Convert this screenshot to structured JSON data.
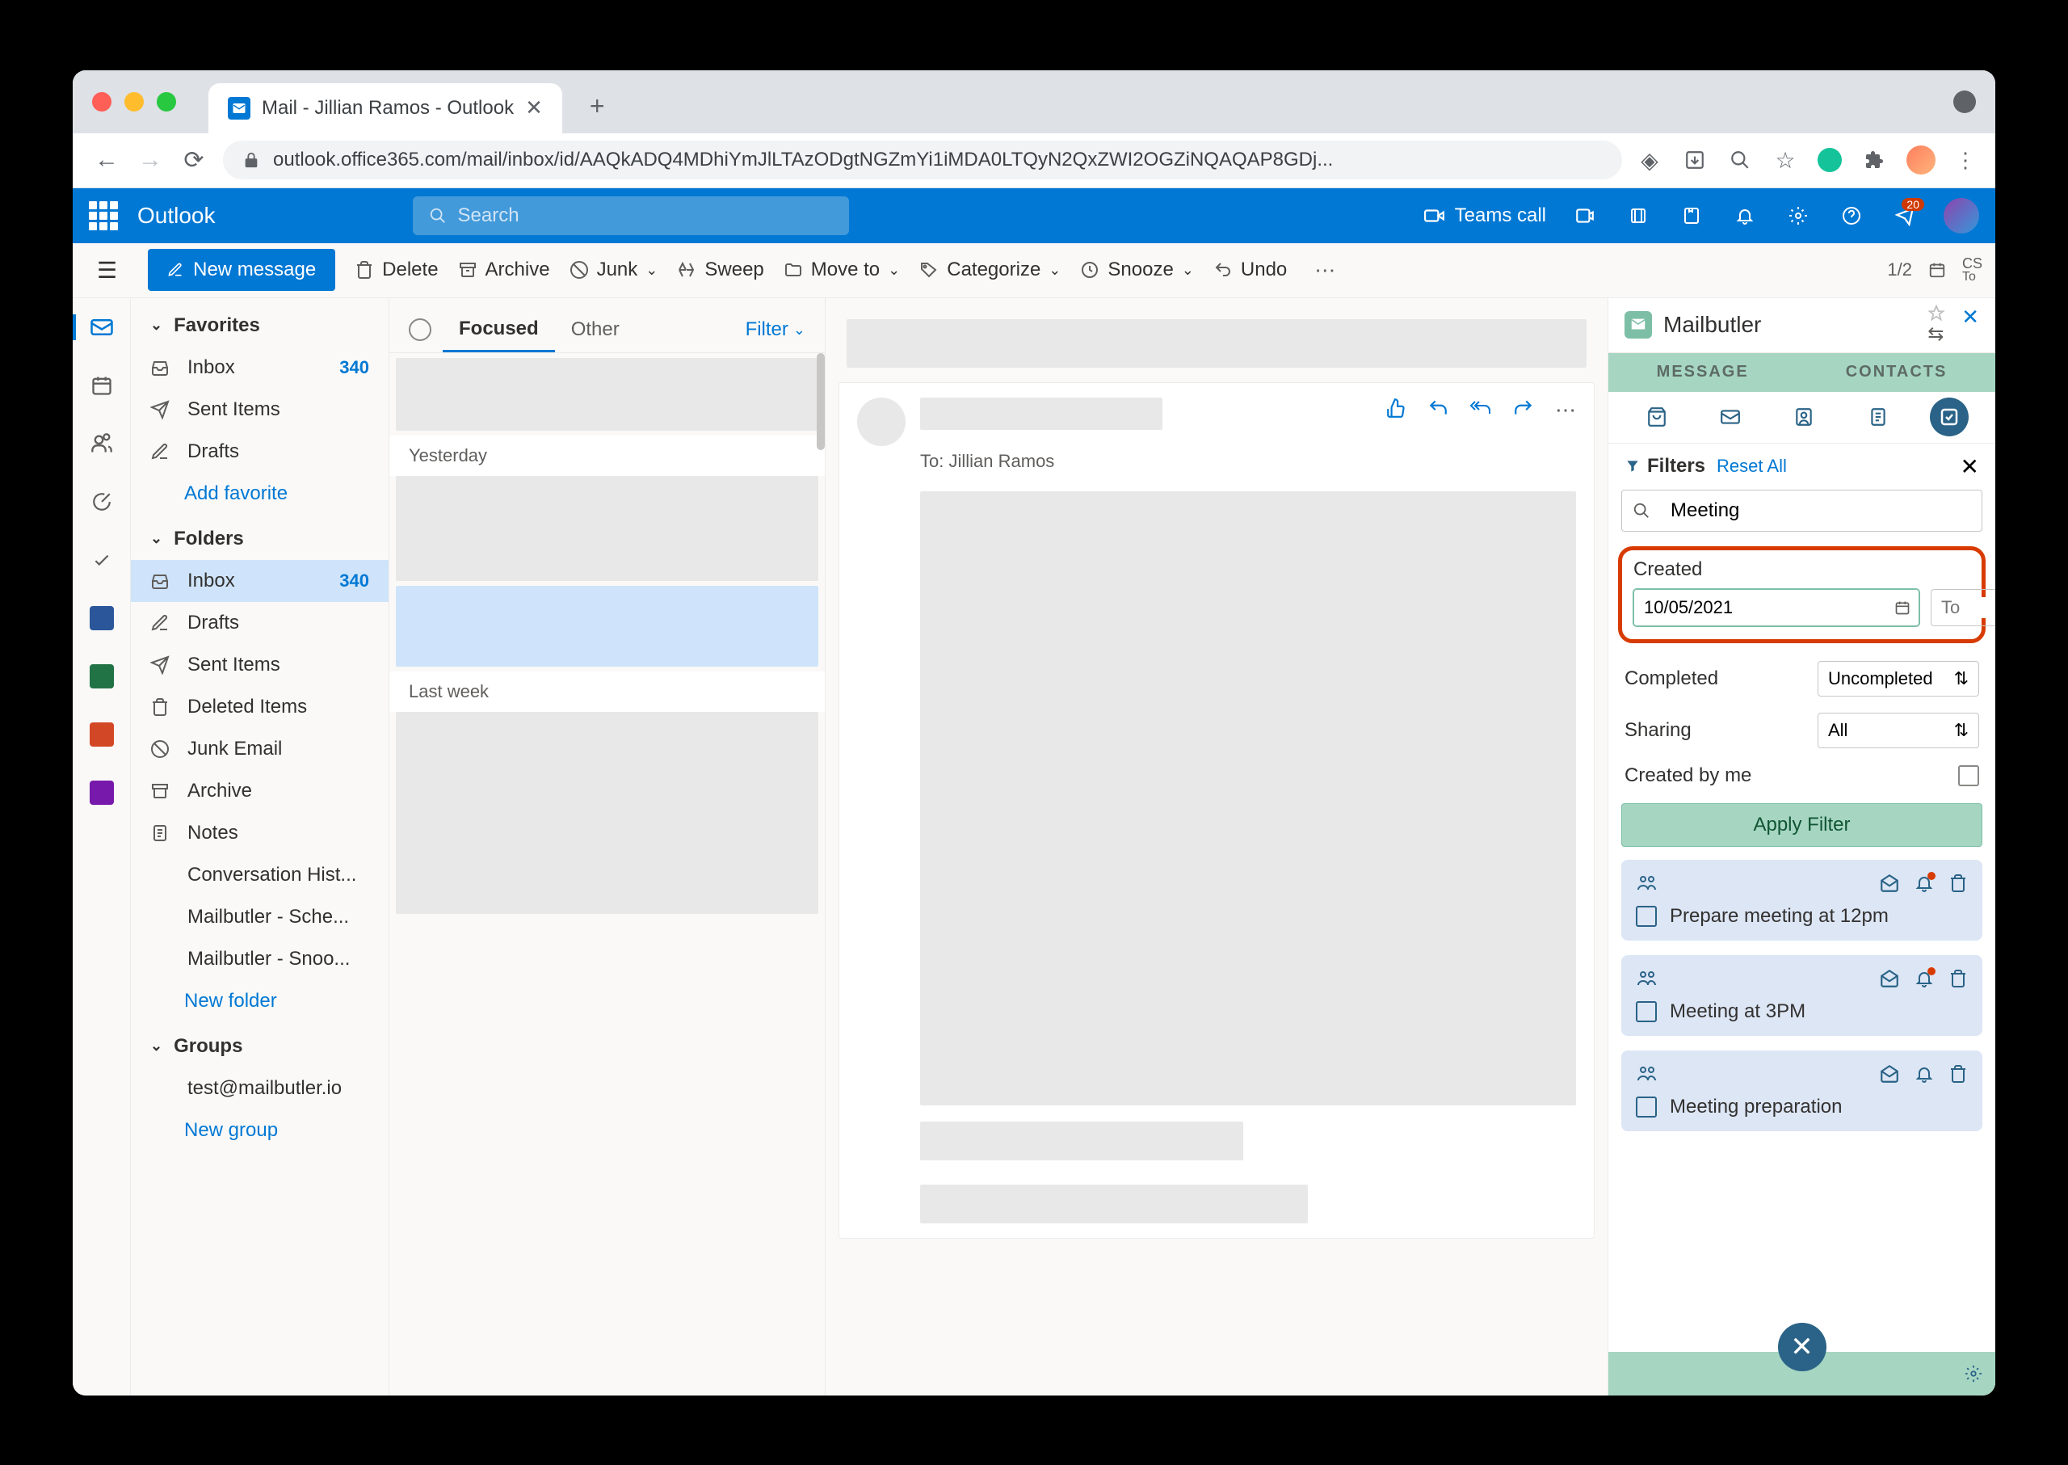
{
  "browser": {
    "tab_title": "Mail - Jillian Ramos - Outlook",
    "url": "outlook.office365.com/mail/inbox/id/AAQkADQ4MDhiYmJlLTAzODgtNGZmYi1iMDA0LTQyN2QxZWI2OGZiNQAQAP8GDj..."
  },
  "header": {
    "brand": "Outlook",
    "search_placeholder": "Search",
    "teams_call": "Teams call",
    "notif_count": "20"
  },
  "commands": {
    "new_message": "New message",
    "delete": "Delete",
    "archive": "Archive",
    "junk": "Junk",
    "sweep": "Sweep",
    "move_to": "Move to",
    "categorize": "Categorize",
    "snooze": "Snooze",
    "undo": "Undo",
    "page": "1/2",
    "cs_label": "CS",
    "cs_sub": "To"
  },
  "folders": {
    "favorites_label": "Favorites",
    "folders_label": "Folders",
    "groups_label": "Groups",
    "add_favorite": "Add favorite",
    "new_folder": "New folder",
    "new_group": "New group",
    "group_email": "test@mailbutler.io",
    "items": {
      "inbox": "Inbox",
      "inbox_count": "340",
      "sent": "Sent Items",
      "drafts": "Drafts",
      "deleted": "Deleted Items",
      "junk": "Junk Email",
      "archive": "Archive",
      "notes": "Notes",
      "conv_hist": "Conversation Hist...",
      "mb_sched": "Mailbutler - Sche...",
      "mb_snooze": "Mailbutler - Snoo..."
    }
  },
  "message_list": {
    "tab_focused": "Focused",
    "tab_other": "Other",
    "filter": "Filter",
    "group_yesterday": "Yesterday",
    "group_lastweek": "Last week"
  },
  "reading": {
    "to_label": "To:",
    "to_value": "Jillian Ramos"
  },
  "mailbutler": {
    "brand": "Mailbutler",
    "tab_message": "MESSAGE",
    "tab_contacts": "CONTACTS",
    "filters_label": "Filters",
    "reset_all": "Reset All",
    "search_value": "Meeting",
    "created_label": "Created",
    "date_from_value": "10/05/2021",
    "date_to_placeholder": "To",
    "completed_label": "Completed",
    "completed_value": "Uncompleted",
    "sharing_label": "Sharing",
    "sharing_value": "All",
    "created_by_me": "Created by me",
    "apply_filter": "Apply Filter",
    "tasks": [
      {
        "text": "Prepare meeting at 12pm",
        "has_alert": true
      },
      {
        "text": "Meeting at 3PM",
        "has_alert": true
      },
      {
        "text": "Meeting preparation",
        "has_alert": false
      }
    ]
  }
}
